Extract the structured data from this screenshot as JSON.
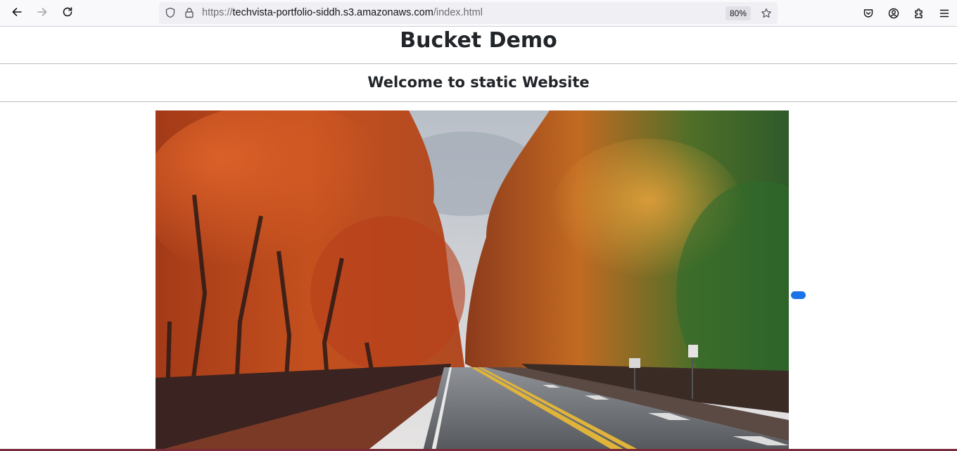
{
  "browser": {
    "url": {
      "scheme": "https://",
      "host": "techvista-portfolio-siddh.s3.amazonaws.com",
      "path": "/index.html"
    },
    "zoom": "80%",
    "icons": {
      "back": "arrow-left-icon",
      "forward": "arrow-right-icon",
      "reload": "reload-icon",
      "tracking": "shield-icon",
      "lock": "lock-icon",
      "bookmark": "star-icon",
      "pocket": "pocket-icon",
      "account": "account-icon",
      "extensions": "puzzle-icon",
      "menu": "hamburger-menu-icon"
    }
  },
  "page": {
    "title": "Bucket Demo",
    "subtitle": "Welcome to static Website",
    "image": {
      "subject": "autumn road lined with red and orange trees"
    }
  },
  "colors": {
    "heading": "#212529",
    "accent_pill": "#1a73e8"
  }
}
